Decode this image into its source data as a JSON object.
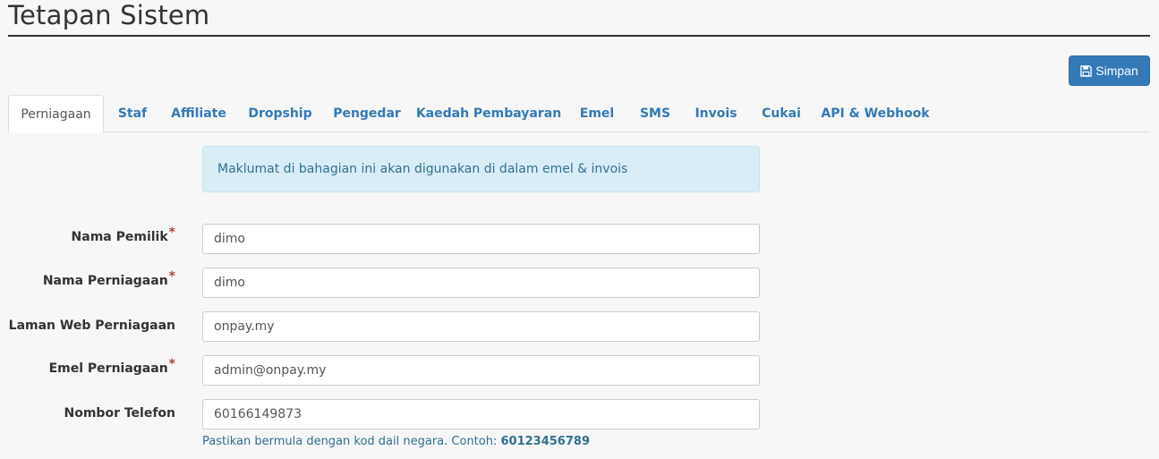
{
  "page": {
    "title": "Tetapan Sistem"
  },
  "toolbar": {
    "save_label": "Simpan",
    "save_icon": "floppy-disk-icon"
  },
  "tabs": [
    {
      "label": "Perniagaan",
      "active": true
    },
    {
      "label": "Staf"
    },
    {
      "label": "Affiliate"
    },
    {
      "label": "Dropship"
    },
    {
      "label": "Pengedar"
    },
    {
      "label": "Kaedah Pembayaran"
    },
    {
      "label": "Emel"
    },
    {
      "label": "SMS"
    },
    {
      "label": "Invois"
    },
    {
      "label": "Cukai"
    },
    {
      "label": "API & Webhook"
    }
  ],
  "alert": {
    "text": "Maklumat di bahagian ini akan digunakan di dalam emel & invois"
  },
  "form": {
    "fields": [
      {
        "label": "Nama Pemilik",
        "required": true,
        "value": "dimo"
      },
      {
        "label": "Nama Perniagaan",
        "required": true,
        "value": "dimo"
      },
      {
        "label": "Laman Web Perniagaan",
        "required": false,
        "value": "onpay.my"
      },
      {
        "label": "Emel Perniagaan",
        "required": true,
        "value": "admin@onpay.my"
      },
      {
        "label": "Nombor Telefon",
        "required": false,
        "value": "60166149873"
      }
    ],
    "required_mark": "*",
    "phone_help": "Pastikan bermula dengan kod dail negara. Contoh: ",
    "phone_example": "60123456789"
  },
  "colors": {
    "primary": "#337ab7",
    "alert_bg": "#d9edf7",
    "alert_text": "#31708f",
    "required": "#a94442"
  }
}
